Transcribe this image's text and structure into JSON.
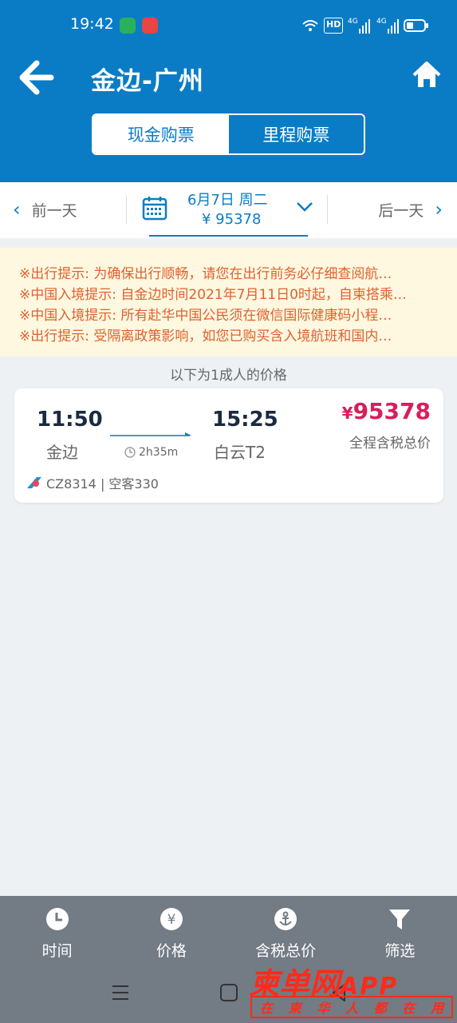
{
  "status_bar": {
    "time": "19:42",
    "network": "4G",
    "hd": "HD"
  },
  "header": {
    "title": "金边-广州",
    "tabs": [
      {
        "label": "现金购票",
        "active": true
      },
      {
        "label": "里程购票",
        "active": false
      }
    ]
  },
  "date_bar": {
    "prev_label": "前一天",
    "next_label": "后一天",
    "date": "6月7日 周二",
    "lowest_price": "¥ 95378"
  },
  "notices": [
    "※出行提示: 为确保出行顺畅，请您在出行前务必仔细查阅航…",
    "※中国入境提示: 自金边时间2021年7月11日0时起，自柬搭乘…",
    "※中国入境提示: 所有赴华中国公民须在微信国际健康码小程…",
    "※出行提示: 受隔离政策影响，如您已购买含入境航班和国内…"
  ],
  "price_note": "以下为1成人的价格",
  "flight": {
    "dep_time": "11:50",
    "dep_airport": "金边",
    "arr_time": "15:25",
    "arr_airport": "白云T2",
    "duration": "2h35m",
    "price_symbol": "¥",
    "price": "95378",
    "price_desc": "全程含税总价",
    "airline_info": "CZ8314 | 空客330"
  },
  "toolbar": [
    {
      "label": "时间",
      "icon": "clock-icon"
    },
    {
      "label": "价格",
      "icon": "yen-icon"
    },
    {
      "label": "含税总价",
      "icon": "anchor-icon"
    },
    {
      "label": "筛选",
      "icon": "filter-icon"
    }
  ],
  "watermark": {
    "brand": "柬单网",
    "app": "APP",
    "slogan": [
      "在",
      "柬",
      "华",
      "人",
      "都",
      "在",
      "用"
    ]
  },
  "colors": {
    "primary": "#0a7cc5",
    "price": "#d81e5b",
    "notice_text": "#e06030",
    "notice_bg": "#fdf8df"
  }
}
